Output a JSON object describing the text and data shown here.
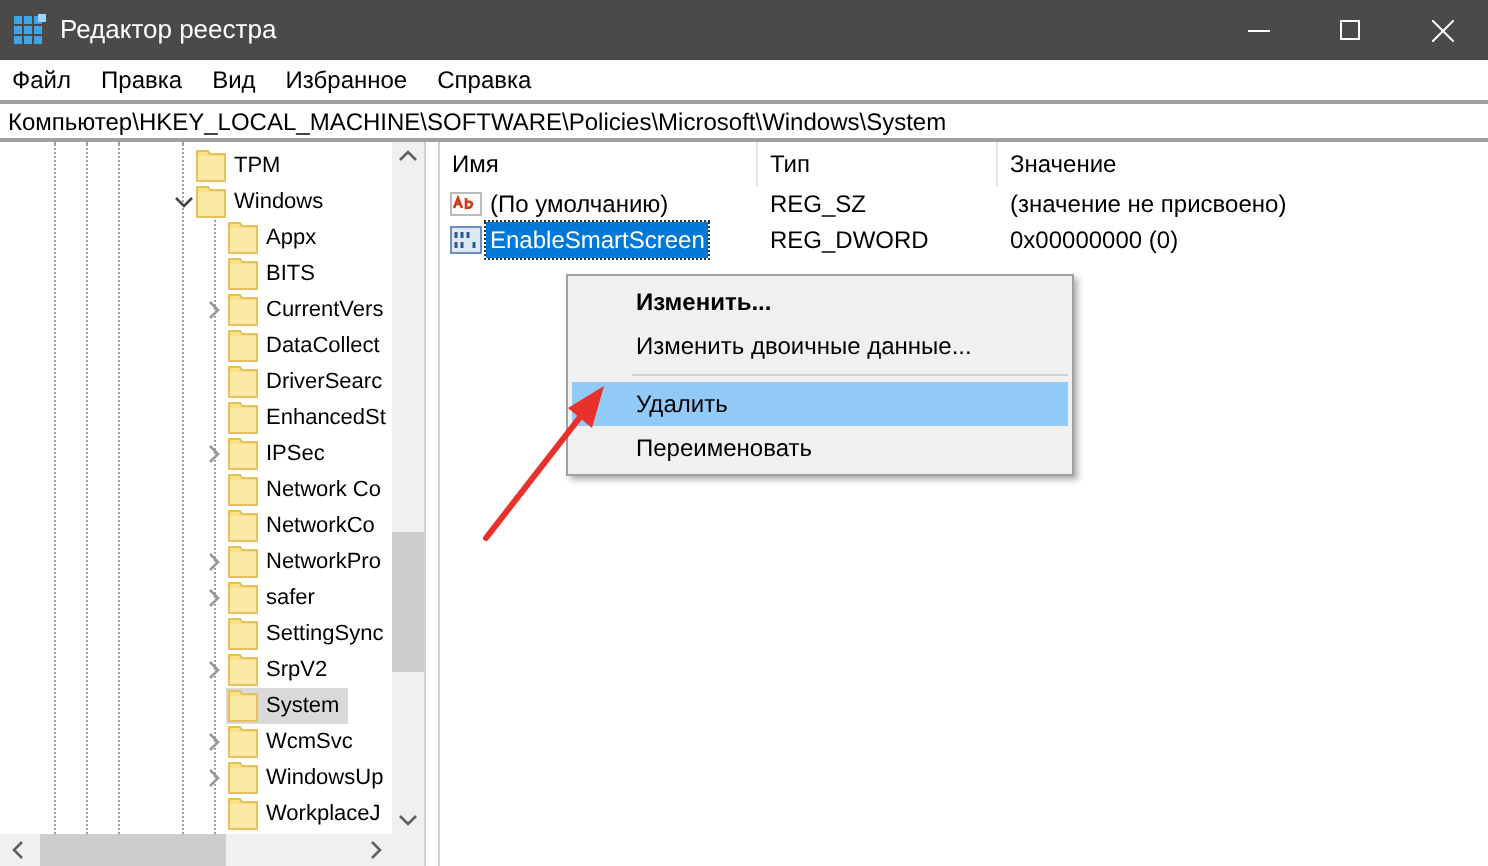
{
  "window": {
    "title": "Редактор реестра"
  },
  "menu": [
    "Файл",
    "Правка",
    "Вид",
    "Избранное",
    "Справка"
  ],
  "address": "Компьютер\\HKEY_LOCAL_MACHINE\\SOFTWARE\\Policies\\Microsoft\\Windows\\System",
  "tree": [
    {
      "label": "TPM",
      "has_children": false,
      "selected": false
    },
    {
      "label": "Windows",
      "has_children": true,
      "expanded": true,
      "selected": false,
      "children": [
        {
          "label": "Appx",
          "has_children": false,
          "selected": false
        },
        {
          "label": "BITS",
          "has_children": false,
          "selected": false
        },
        {
          "label": "CurrentVers",
          "has_children": true,
          "selected": false
        },
        {
          "label": "DataCollect",
          "has_children": false,
          "selected": false
        },
        {
          "label": "DriverSearc",
          "has_children": false,
          "selected": false
        },
        {
          "label": "EnhancedSt",
          "has_children": false,
          "selected": false
        },
        {
          "label": "IPSec",
          "has_children": true,
          "selected": false
        },
        {
          "label": "Network Co",
          "has_children": false,
          "selected": false
        },
        {
          "label": "NetworkCo",
          "has_children": false,
          "selected": false
        },
        {
          "label": "NetworkPro",
          "has_children": true,
          "selected": false
        },
        {
          "label": "safer",
          "has_children": true,
          "selected": false
        },
        {
          "label": "SettingSync",
          "has_children": false,
          "selected": false
        },
        {
          "label": "SrpV2",
          "has_children": true,
          "selected": false
        },
        {
          "label": "System",
          "has_children": false,
          "selected": true
        },
        {
          "label": "WcmSvc",
          "has_children": true,
          "selected": false
        },
        {
          "label": "WindowsUp",
          "has_children": true,
          "selected": false
        },
        {
          "label": "WorkplaceJ",
          "has_children": false,
          "selected": false
        }
      ]
    }
  ],
  "table": {
    "columns": [
      "Имя",
      "Тип",
      "Значение"
    ],
    "rows": [
      {
        "kind": "string",
        "selected": false,
        "cells": [
          "(По умолчанию)",
          "REG_SZ",
          "(значение не присвоено)"
        ]
      },
      {
        "kind": "binary",
        "selected": true,
        "cells": [
          "EnableSmartScreen",
          "REG_DWORD",
          "0x00000000 (0)"
        ]
      }
    ]
  },
  "context_menu": [
    {
      "kind": "item",
      "label": "Изменить...",
      "default": true,
      "selected": false
    },
    {
      "kind": "item",
      "label": "Изменить двоичные данные...",
      "default": false,
      "selected": false
    },
    {
      "kind": "separator"
    },
    {
      "kind": "item",
      "label": "Удалить",
      "default": false,
      "selected": true
    },
    {
      "kind": "item",
      "label": "Переименовать",
      "default": false,
      "selected": false
    }
  ]
}
